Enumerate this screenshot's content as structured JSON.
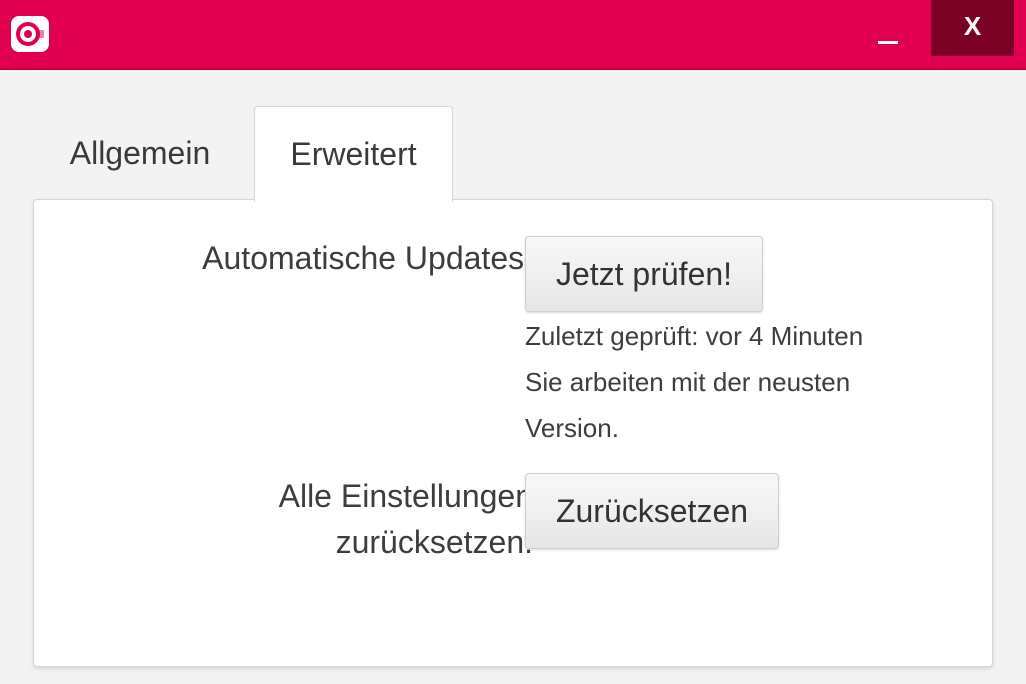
{
  "window": {
    "app_icon": "camera-record-icon",
    "minimize_label": "_",
    "close_label": "X",
    "accent_color": "#e0004f",
    "close_bg_color": "#7a0024"
  },
  "tabs": [
    {
      "label": "Allgemein",
      "active": false
    },
    {
      "label": "Erweitert",
      "active": true
    }
  ],
  "settings": {
    "updates_label": "Automatische Updates:",
    "check_button": "Jetzt prüfen!",
    "last_checked": "Zuletzt geprüft: vor 4 Minuten",
    "status": "Sie arbeiten mit der neusten Version.",
    "reset_label_line1": "Alle Einstellungen",
    "reset_label_line2": "zurücksetzen:",
    "reset_button": "Zurücksetzen"
  }
}
